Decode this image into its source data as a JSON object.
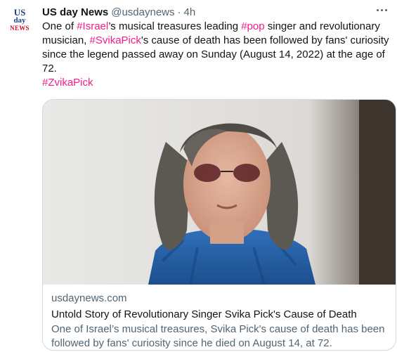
{
  "tweet": {
    "avatar": {
      "line1": "US",
      "line2": "day",
      "line3": "NEWS"
    },
    "author_name": "US day News",
    "handle": "@usdaynews",
    "separator": "·",
    "time": "4h",
    "text": {
      "p1": "One of ",
      "h1": "#Israel",
      "p2": "’s musical treasures leading ",
      "h2": "#pop",
      "p3": " singer and revolutionary musician, ",
      "h3": "#SvikaPick",
      "p4": "'s cause of death has been followed by fans' curiosity since the legend passed away on Sunday (August 14, 2022) at the age of 72.",
      "h4": "#ZvikaPick"
    },
    "more_icon": "more-horizontal-icon"
  },
  "card": {
    "domain": "usdaynews.com",
    "title": "Untold Story of Revolutionary Singer Svika Pick's Cause of Death",
    "description": "One of Israel’s musical treasures, Svika Pick's cause of death has been followed by fans' curiosity since he died on August 14, at 72."
  },
  "colors": {
    "hashtag": "#f41d86",
    "secondary_text": "#536471",
    "border": "#cfd9de"
  }
}
